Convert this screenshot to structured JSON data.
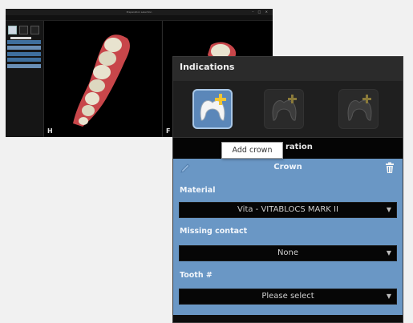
{
  "app": {
    "title": "Preparation selection",
    "window_controls": "– □ ×",
    "left_view_label": "",
    "right_view_label": "",
    "left_view_letter": "H",
    "right_view_letter": "F"
  },
  "panel": {
    "title": "Indications",
    "buttons": [
      {
        "name": "Add crown",
        "state": "active"
      },
      {
        "name": "",
        "state": "disabled"
      },
      {
        "name": "",
        "state": "disabled"
      }
    ],
    "tab_label": "ration",
    "tooltip": "Add crown"
  },
  "crown": {
    "title": "Crown",
    "material_label": "Material",
    "material_value": "Vita - VITABLOCS MARK II",
    "missing_contact_label": "Missing contact",
    "missing_contact_value": "None",
    "tooth_label": "Tooth #",
    "tooth_value": "Please select"
  },
  "colors": {
    "accent": "#6a97c5",
    "active_button": "#5b87b9",
    "panel_bg": "#0d0d0d",
    "header_bg": "#2b2b2b",
    "plus_icon": "#f2c531",
    "gum": "#c8464a",
    "tooth": "#e8e3cf"
  },
  "icons": {
    "pencil": "pencil-icon",
    "trash": "trash-icon",
    "dropdown": "chevron-down-icon",
    "crown": "crown-icon"
  }
}
